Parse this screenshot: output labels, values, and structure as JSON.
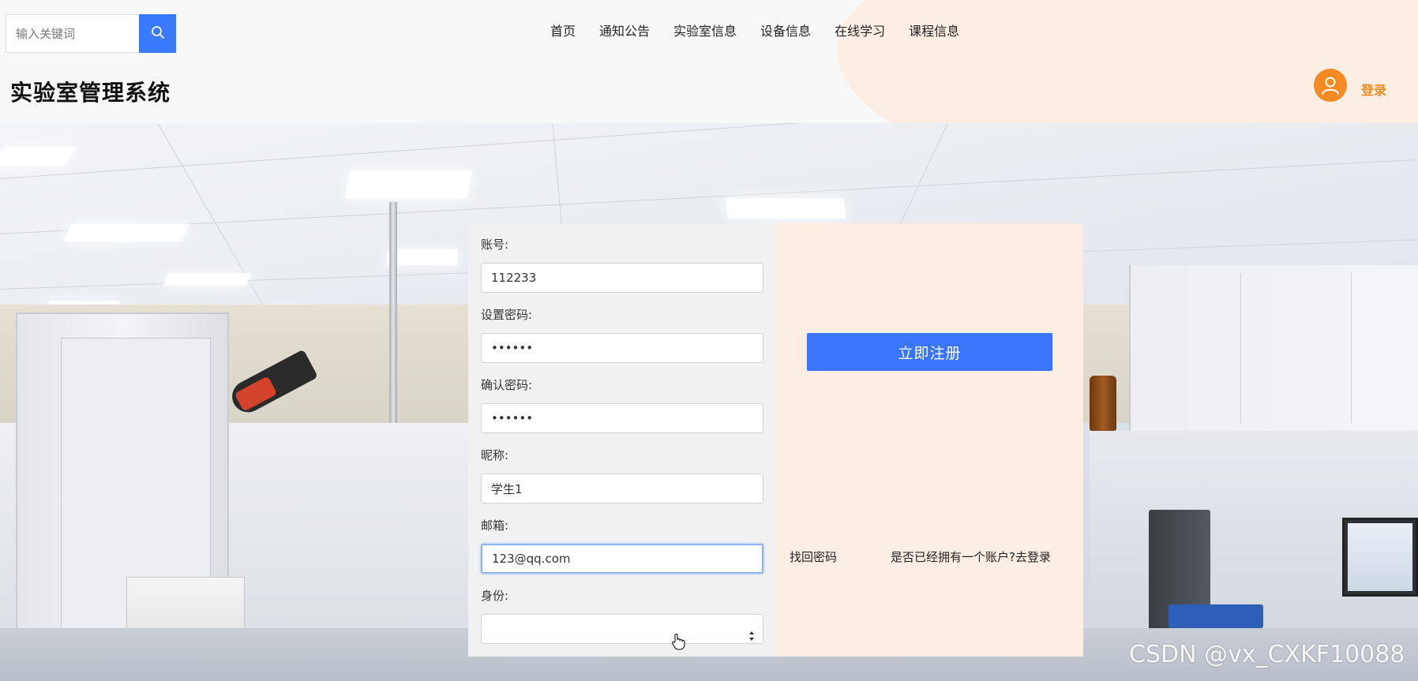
{
  "header": {
    "search": {
      "placeholder": "输入关键词"
    },
    "nav": [
      {
        "label": "首页"
      },
      {
        "label": "通知公告"
      },
      {
        "label": "实验室信息"
      },
      {
        "label": "设备信息"
      },
      {
        "label": "在线学习"
      },
      {
        "label": "课程信息"
      }
    ],
    "site_title": "实验室管理系统",
    "login_label": "登录",
    "accent_color": "#3a7afe",
    "login_color": "#f08a24"
  },
  "register_form": {
    "fields": {
      "account": {
        "label": "账号:",
        "value": "112233"
      },
      "password": {
        "label": "设置密码:",
        "value": "••••••"
      },
      "confirm_password": {
        "label": "确认密码:",
        "value": "••••••"
      },
      "nickname": {
        "label": "昵称:",
        "value": "学生1"
      },
      "email": {
        "label": "邮箱:",
        "value": "123@qq.com"
      },
      "role": {
        "label": "身份:",
        "value": ""
      }
    },
    "register_button": "立即注册",
    "forgot_password": "找回密码",
    "has_account": "是否已经拥有一个账户?去登录",
    "button_color": "#3a74f8",
    "panel_right_color": "#fdeee3"
  },
  "watermark": "CSDN @vx_CXKF10088",
  "icons": {
    "search": "search-icon",
    "avatar": "user-avatar-icon",
    "select_arrows": "select-arrows-icon",
    "cursor": "hand-cursor-icon"
  }
}
